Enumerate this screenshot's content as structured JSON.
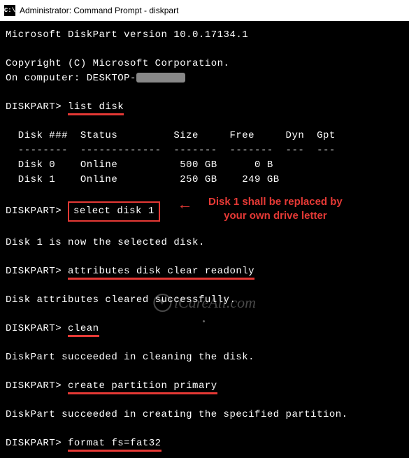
{
  "titlebar": {
    "icon_text": "C:\\",
    "title": "Administrator: Command Prompt - diskpart"
  },
  "terminal": {
    "version_line": "Microsoft DiskPart version 10.0.17134.1",
    "copyright_line": "Copyright (C) Microsoft Corporation.",
    "computer_prefix": "On computer: DESKTOP-",
    "prompt": "DISKPART>",
    "cmd_list_disk": "list disk",
    "table_header": "  Disk ###  Status         Size     Free     Dyn  Gpt",
    "table_divider": "  --------  -------------  -------  -------  ---  ---",
    "table_row_0": "  Disk 0    Online          500 GB      0 B",
    "table_row_1": "  Disk 1    Online          250 GB    249 GB",
    "cmd_select_disk": "select disk 1",
    "msg_selected": "Disk 1 is now the selected disk.",
    "cmd_attributes": "attributes disk clear readonly",
    "msg_attributes": "Disk attributes cleared successfully.",
    "cmd_clean": "clean",
    "msg_clean": "DiskPart succeeded in cleaning the disk.",
    "cmd_create_partition": "create partition primary",
    "msg_partition": "DiskPart succeeded in creating the specified partition.",
    "cmd_format": "format fs=fat32"
  },
  "annotation": {
    "text_line1": "Disk 1 shall be replaced by",
    "text_line2": "your own drive letter",
    "arrow": "←"
  },
  "watermark": {
    "text": "iCareAll.com",
    "icon": "♥"
  },
  "chart_data": {
    "type": "table",
    "title": "DISKPART list disk",
    "columns": [
      "Disk ###",
      "Status",
      "Size",
      "Free",
      "Dyn",
      "Gpt"
    ],
    "rows": [
      {
        "disk": "Disk 0",
        "status": "Online",
        "size": "500 GB",
        "free": "0 B",
        "dyn": "",
        "gpt": ""
      },
      {
        "disk": "Disk 1",
        "status": "Online",
        "size": "250 GB",
        "free": "249 GB",
        "dyn": "",
        "gpt": ""
      }
    ]
  }
}
